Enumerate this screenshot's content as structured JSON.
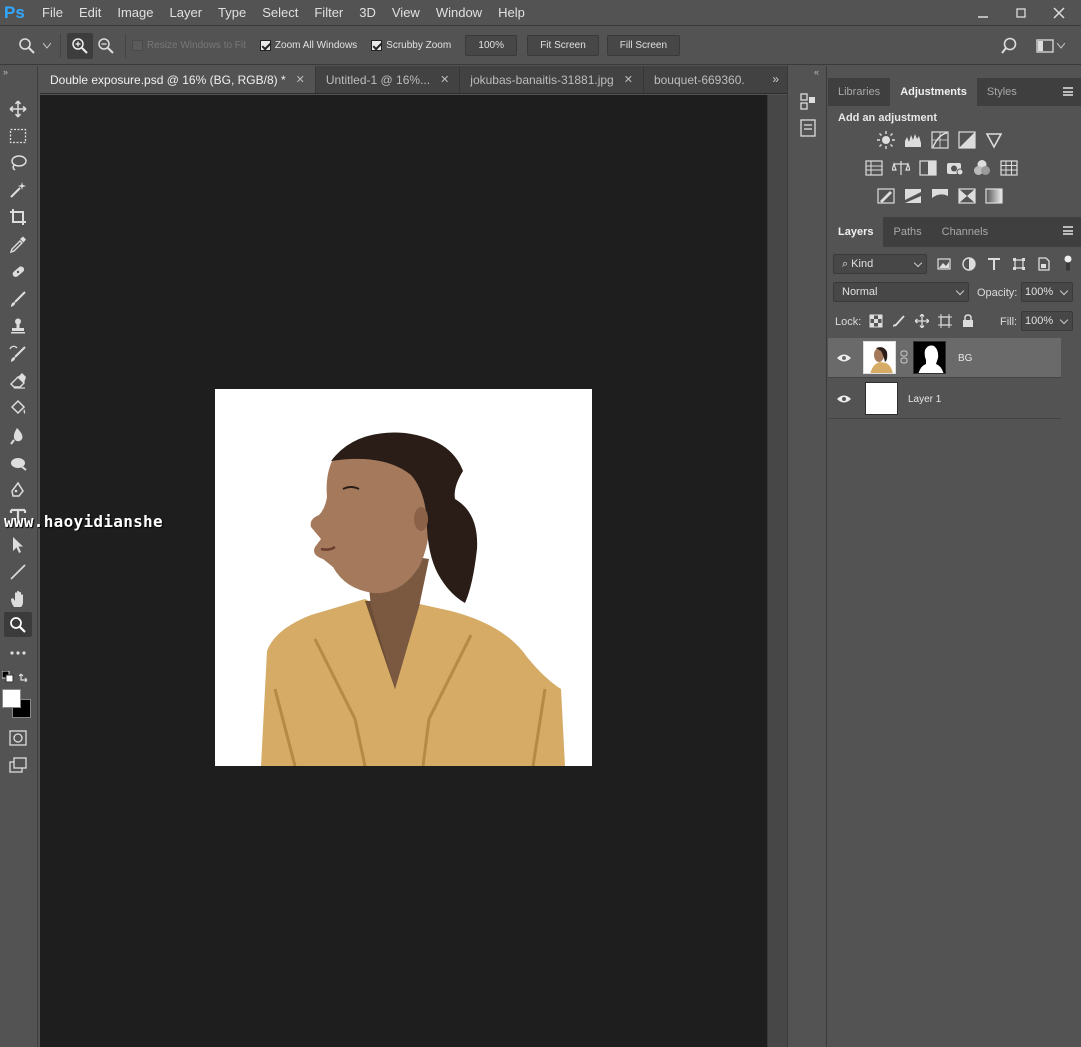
{
  "app": {
    "logo": "Ps",
    "accent": "#31a8ff"
  },
  "menu": [
    "File",
    "Edit",
    "Image",
    "Layer",
    "Type",
    "Select",
    "Filter",
    "3D",
    "View",
    "Window",
    "Help"
  ],
  "options_bar": {
    "resize_windows": "Resize Windows to Fit",
    "zoom_all": "Zoom All Windows",
    "scrubby": "Scrubby Zoom",
    "zoom_value": "100%",
    "fit_screen": "Fit Screen",
    "fill_screen": "Fill Screen"
  },
  "tabs": [
    {
      "label": "Double exposure.psd @ 16% (BG, RGB/8) *",
      "active": true
    },
    {
      "label": "Untitled-1 @ 16%...",
      "active": false
    },
    {
      "label": "jokubas-banaitis-31881.jpg",
      "active": false
    },
    {
      "label": "bouquet-669360.",
      "active": false
    }
  ],
  "tab_overflow": "»",
  "watermark": "www.haoyidianshe",
  "panels": {
    "top_tabs": [
      "Libraries",
      "Adjustments",
      "Styles"
    ],
    "active_top_tab": "Adjustments",
    "adjustments_title": "Add an adjustment",
    "layer_tabs": [
      "Layers",
      "Paths",
      "Channels"
    ],
    "active_layer_tab": "Layers",
    "kind_label": "Kind",
    "blend_mode": "Normal",
    "opacity_label": "Opacity:",
    "opacity_value": "100%",
    "lock_label": "Lock:",
    "fill_label": "Fill:",
    "fill_value": "100%"
  },
  "layers": [
    {
      "name": "BG",
      "selected": true,
      "visible": true
    },
    {
      "name": "Layer 1",
      "selected": false,
      "visible": true
    }
  ]
}
